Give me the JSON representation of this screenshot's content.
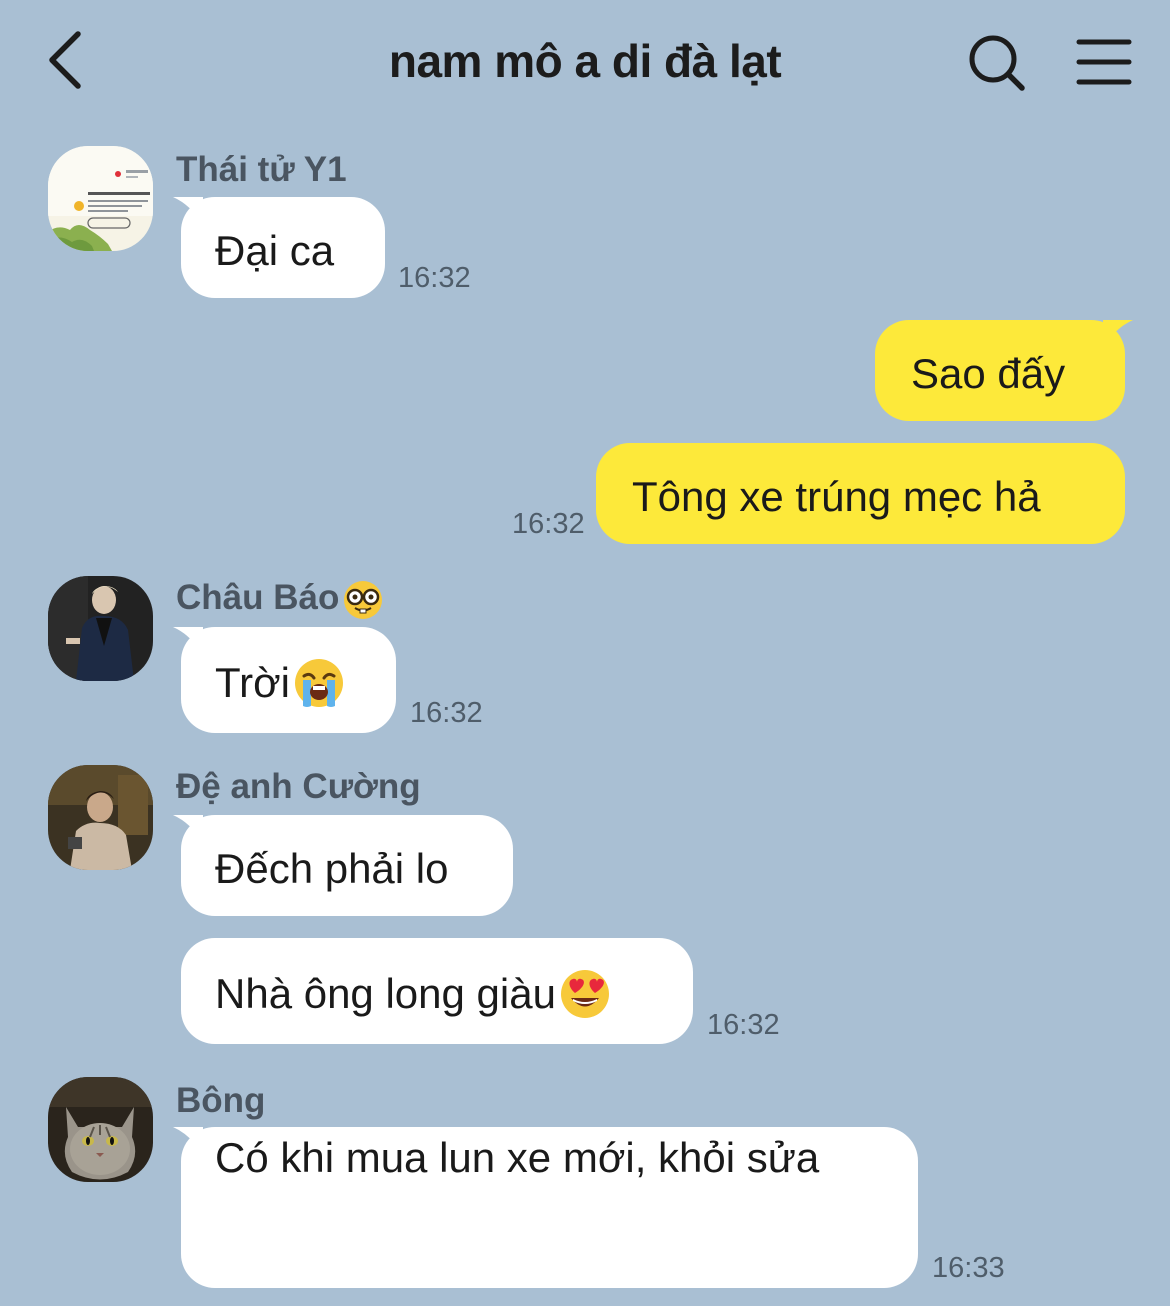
{
  "header": {
    "title": "nam mô a di đà lạt"
  },
  "messages": [
    {
      "sender": "Thái tử Y1",
      "text": "Đại ca",
      "time": "16:32"
    },
    {
      "text": "Sao đấy"
    },
    {
      "text": "Tông xe trúng mẹc hả",
      "time": "16:32"
    },
    {
      "sender": "Châu Báo",
      "sender_emoji": "nerd-face",
      "text": "Trời",
      "text_emoji": "loudly-crying-face",
      "time": "16:32"
    },
    {
      "sender": "Đệ anh Cường",
      "text": "Đếch phải lo"
    },
    {
      "text": "Nhà ông long giàu",
      "text_emoji": "heart-eyes-face",
      "time": "16:32"
    },
    {
      "sender": "Bông",
      "text": "Có khi mua lun xe mới, khỏi sửa",
      "time": "16:33"
    }
  ]
}
